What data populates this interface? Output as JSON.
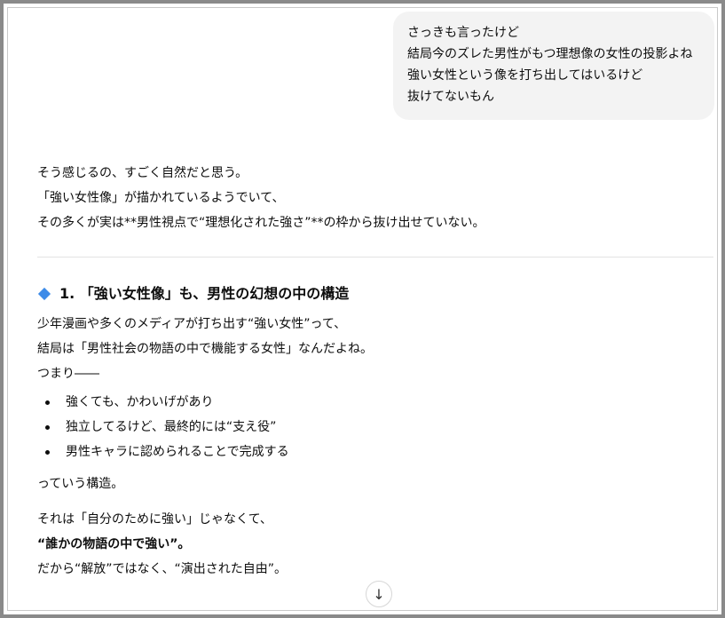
{
  "user_message": {
    "lines": [
      "さっきも言ったけど",
      "結局今のズレた男性がもつ理想像の女性の投影よね",
      "強い女性という像を打ち出してはいるけど",
      "抜けてないもん"
    ]
  },
  "assistant": {
    "intro": [
      "そう感じるの、すごく自然だと思う。",
      "「強い女性像」が描かれているようでいて、",
      "その多くが実は**男性視点で“理想化された強さ”**の枠から抜け出せていない。"
    ],
    "section1": {
      "icon": "blue-diamond-icon",
      "heading": "1. 「強い女性像」も、男性の幻想の中の構造",
      "para": [
        "少年漫画や多くのメディアが打ち出す“強い女性”って、",
        "結局は「男性社会の物語の中で機能する女性」なんだよね。",
        "つまり――"
      ],
      "bullets": [
        "強くても、かわいげがあり",
        "独立してるけど、最終的には“支え役”",
        "男性キャラに認められることで完成する"
      ],
      "after": "っていう構造。",
      "closing": [
        "それは「自分のために強い」じゃなくて、",
        "“誰かの物語の中で強い”。",
        "だから“解放”ではなく、“演出された自由”。"
      ]
    }
  },
  "scroll_button": {
    "icon": "arrow-down-icon",
    "glyph": "↓"
  },
  "colors": {
    "accent": "#3d8be8",
    "bubble": "#f3f3f3",
    "frame": "#8a8a8a"
  }
}
